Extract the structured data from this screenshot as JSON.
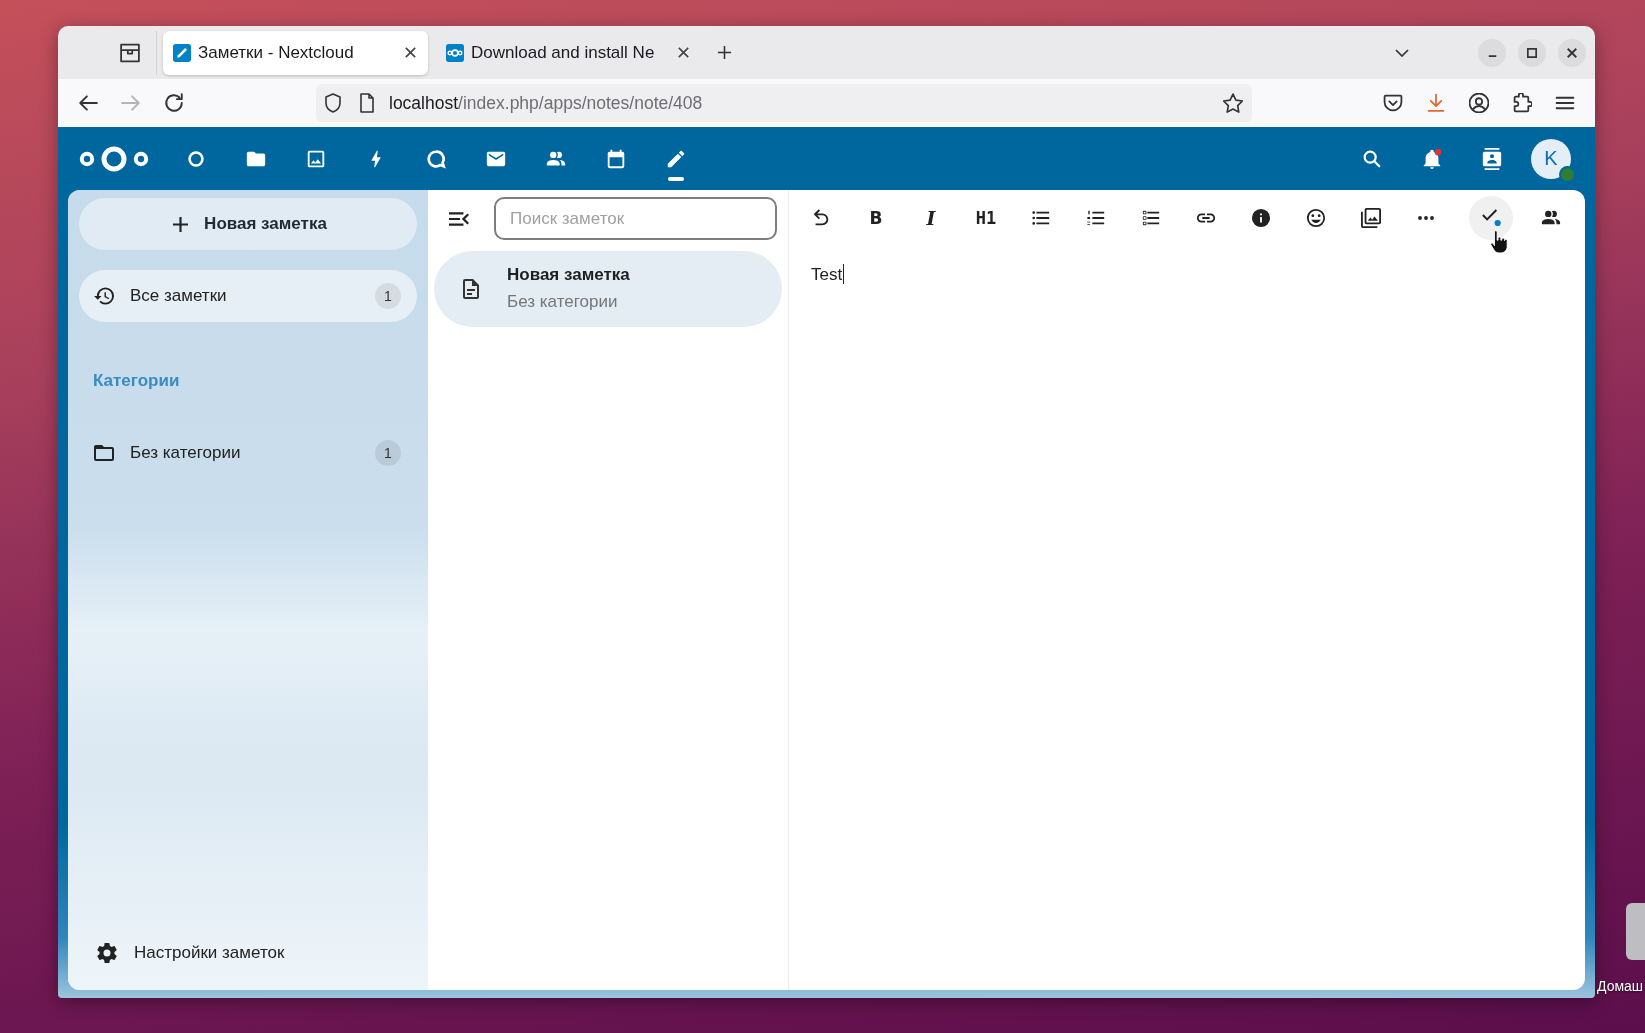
{
  "browser": {
    "tabs": [
      {
        "kind": "notes",
        "title": "Заметки - Nextcloud",
        "selected": true
      },
      {
        "kind": "nextcloud",
        "title": "Download and install Ne",
        "selected": false
      }
    ],
    "nav": [
      {
        "kind": "back",
        "disabled": false
      },
      {
        "kind": "forward",
        "disabled": true
      },
      {
        "kind": "reload",
        "disabled": false
      }
    ],
    "address": {
      "host": "localhost",
      "path": "/index.php/apps/notes/note/408"
    },
    "tools": [
      {
        "kind": "pocket",
        "highlighted": false
      },
      {
        "kind": "downloads",
        "highlighted": true
      },
      {
        "kind": "account",
        "highlighted": false
      },
      {
        "kind": "extensions",
        "highlighted": false
      },
      {
        "kind": "menu",
        "highlighted": false
      }
    ]
  },
  "header": {
    "apps": [
      {
        "kind": "dashboard",
        "selected": false
      },
      {
        "kind": "files",
        "selected": false
      },
      {
        "kind": "photos",
        "selected": false
      },
      {
        "kind": "activity",
        "selected": false
      },
      {
        "kind": "talk",
        "selected": false
      },
      {
        "kind": "mail",
        "selected": false
      },
      {
        "kind": "contacts",
        "selected": false
      },
      {
        "kind": "calendar",
        "selected": false
      },
      {
        "kind": "notes",
        "selected": true
      }
    ],
    "notifications_unread": true,
    "avatar": {
      "initial": "K",
      "online": true
    }
  },
  "sidebar": {
    "new_note": "Новая заметка",
    "items": [
      {
        "label": "Все заметки",
        "count": "1",
        "selected": true
      }
    ],
    "categories_heading": "Категории",
    "categories": [
      {
        "label": "Без категории",
        "count": "1",
        "selected": false
      }
    ],
    "settings": "Настройки заметок"
  },
  "notes_list": {
    "search": {
      "placeholder": "Поиск заметок"
    },
    "notes": [
      {
        "title": "Новая заметка",
        "category": "Без категории",
        "selected": true
      }
    ]
  },
  "editor": {
    "toolbar": [
      {
        "kind": "undo",
        "hovered": false
      },
      {
        "kind": "bold",
        "label": "B",
        "hovered": false
      },
      {
        "kind": "italic",
        "label": "I",
        "hovered": false
      },
      {
        "kind": "heading",
        "label": "H1",
        "hovered": false
      },
      {
        "kind": "bullet-list",
        "hovered": false
      },
      {
        "kind": "numbered-list",
        "hovered": false
      },
      {
        "kind": "checklist",
        "hovered": false
      },
      {
        "kind": "link",
        "hovered": false
      },
      {
        "kind": "info",
        "hovered": false
      },
      {
        "kind": "emoji",
        "hovered": false
      },
      {
        "kind": "image",
        "hovered": false
      },
      {
        "kind": "more",
        "hovered": false
      },
      {
        "kind": "save-status",
        "hovered": true,
        "dot": true
      },
      {
        "kind": "sessions",
        "hovered": false
      }
    ],
    "content": "Test"
  },
  "desktop": {
    "icon_label": "Домаш"
  }
}
